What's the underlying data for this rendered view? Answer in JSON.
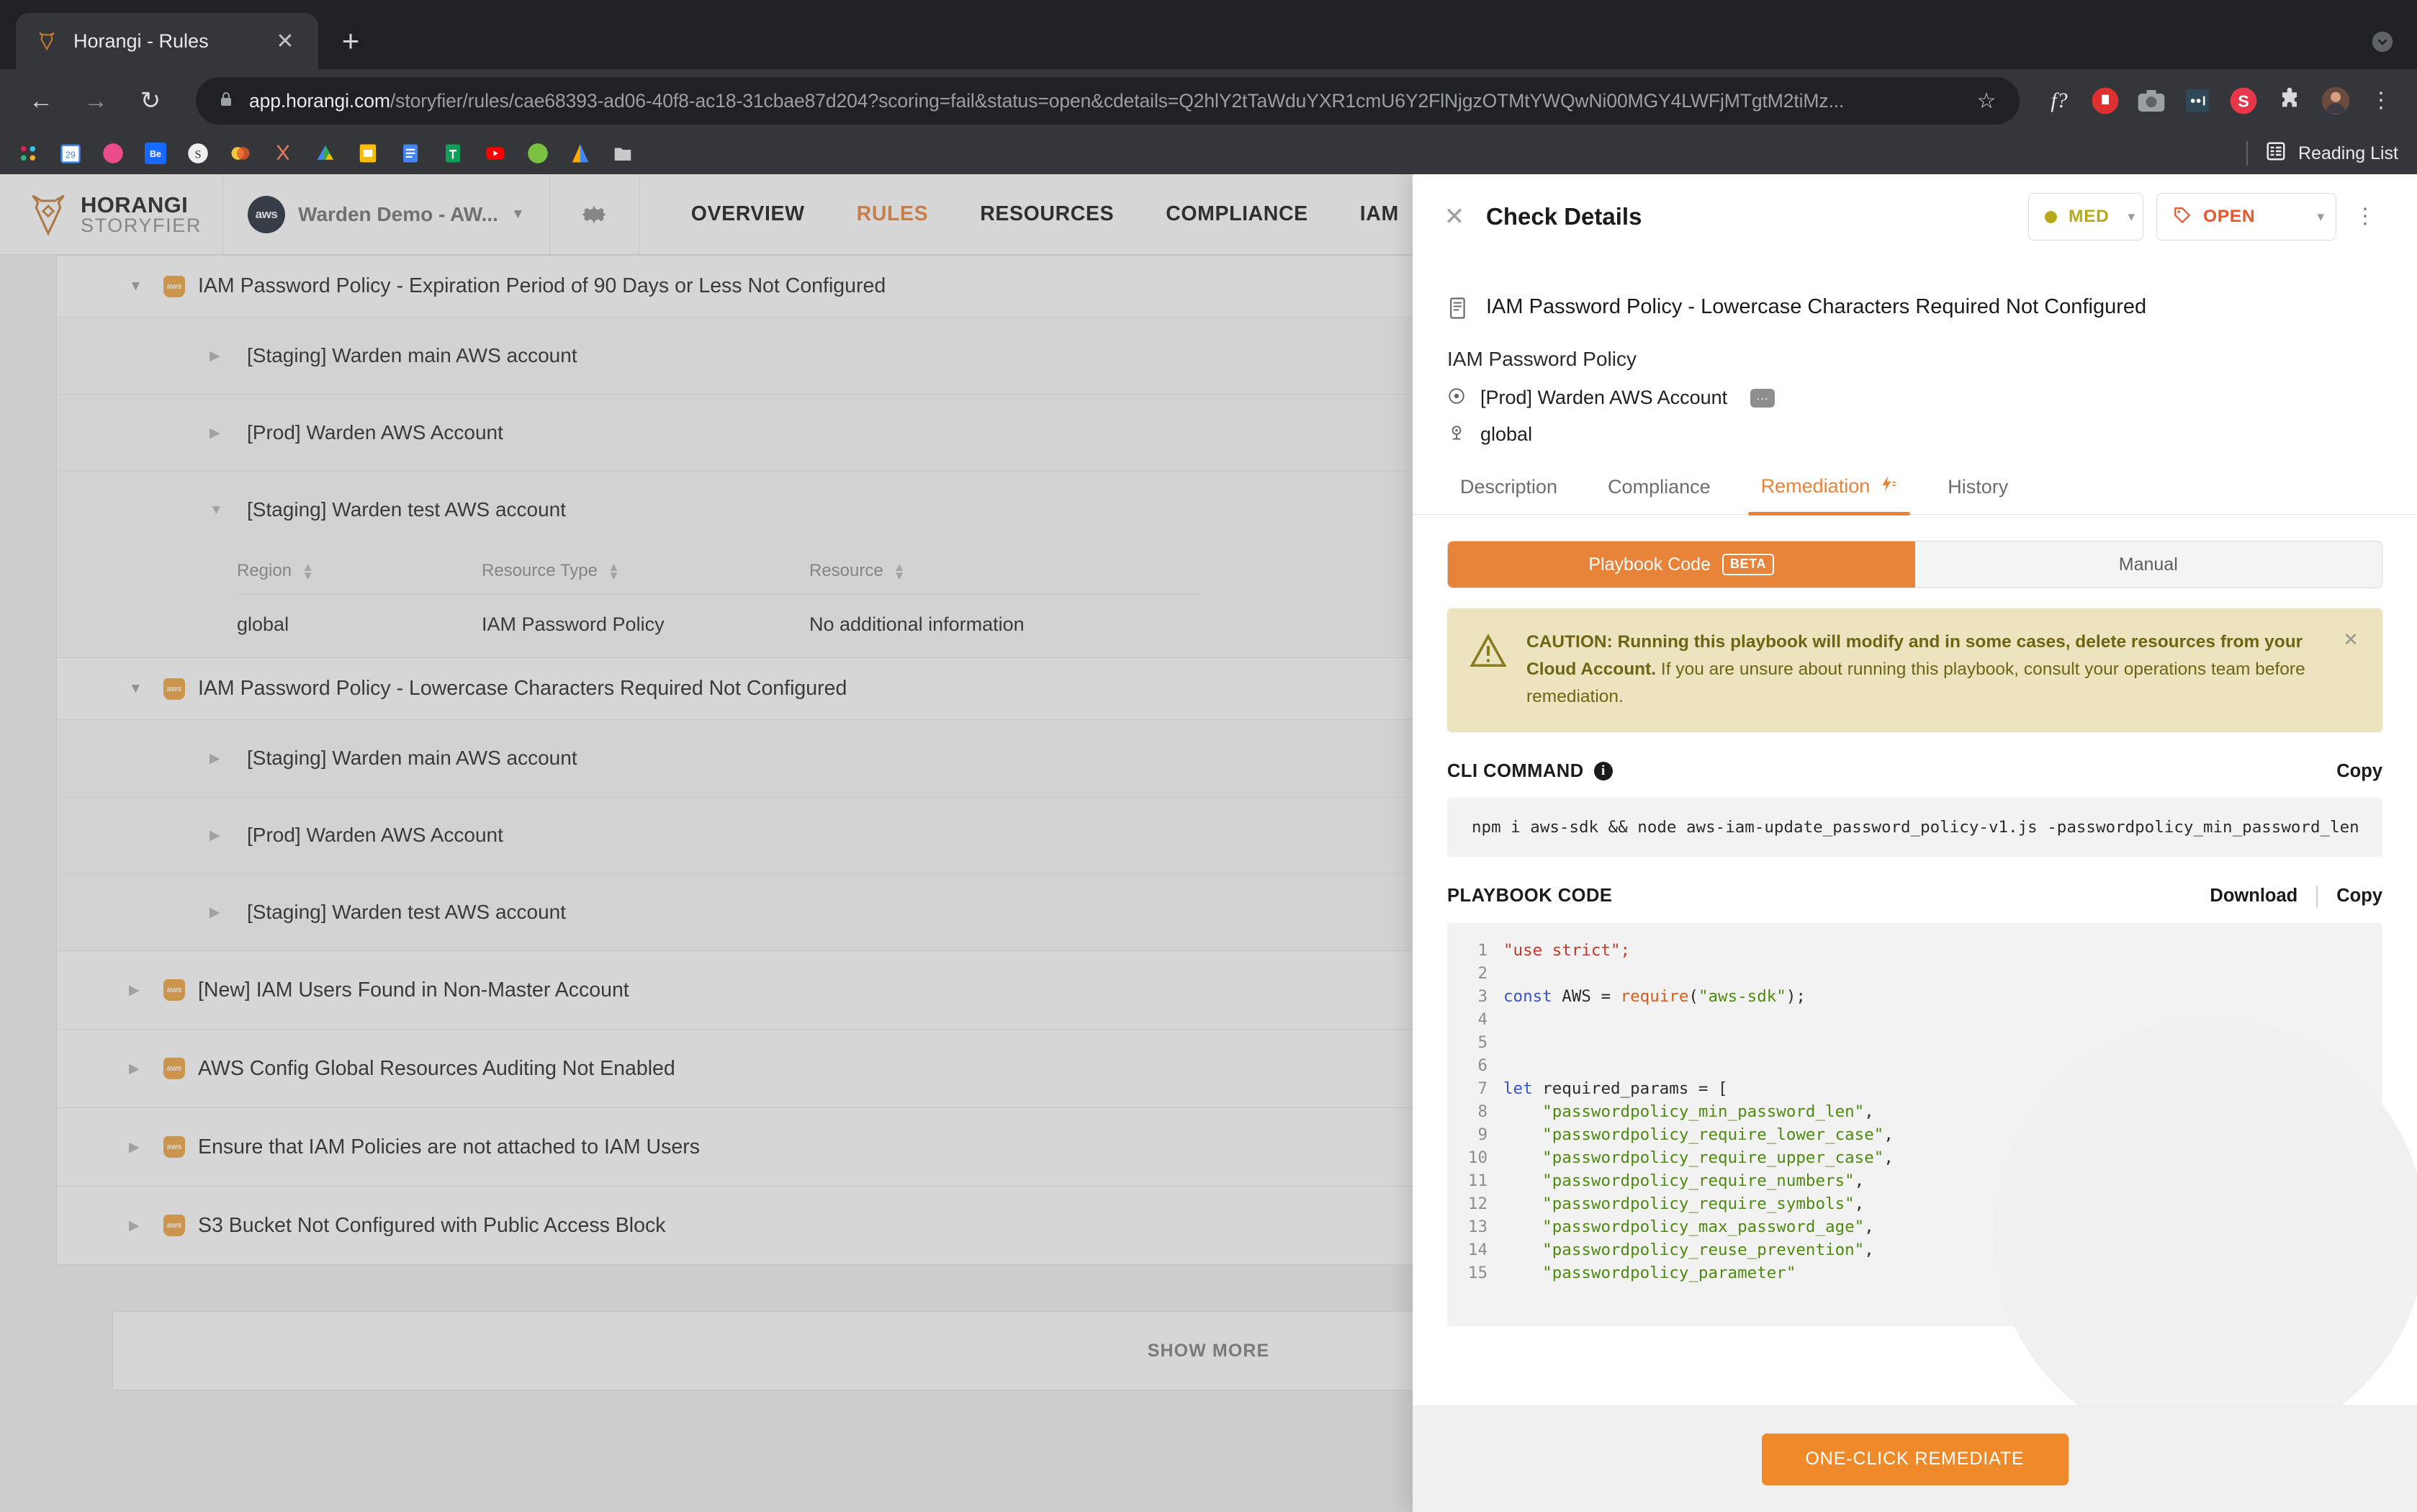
{
  "browser": {
    "tab": {
      "title": "Horangi - Rules",
      "favicon_icon": "horangi-favicon",
      "close_icon": "close-icon"
    },
    "new_tab_icon": "plus-icon",
    "window_collapse_icon": "chevron-down-circle-icon",
    "back_icon": "arrow-left-icon",
    "forward_icon": "arrow-right-icon",
    "reload_icon": "reload-icon",
    "lock_icon": "lock-icon",
    "url_host": "app.horangi.com",
    "url_path": "/storyfier/rules/cae68393-ad06-40f8-ac18-31cbae87d204?scoring=fail&status=open&cdetails=Q2hlY2tTaWduYXR1cmU6Y2FlNjgzOTMtYWQwNi00MGY4LWFjMTgtM2tiMz...",
    "star_icon": "bookmark-star-icon",
    "extensions": [
      "fx-icon",
      "adblock-icon",
      "screenshot-icon",
      "dots-extension-icon",
      "s-extension-icon",
      "puzzle-icon",
      "profile-avatar"
    ],
    "menu_icon": "kebab-menu-icon",
    "bookmarks": [
      "slack-icon",
      "calendar-icon",
      "dribbble-icon",
      "behance-icon",
      "invision-icon",
      "colors-icon",
      "scissors-icon",
      "drive-icon",
      "keep-icon",
      "docs-icon",
      "sheets-icon",
      "youtube-icon",
      "evernote-icon",
      "analytics-icon",
      "folder-icon"
    ],
    "reading_list": {
      "label": "Reading List",
      "icon": "reading-list-icon"
    }
  },
  "app": {
    "logo": {
      "line1": "HORANGI",
      "line2": "STORYFIER",
      "icon": "horangi-tiger-logo"
    },
    "account": {
      "name": "Warden Demo - AW...",
      "badge": "aws",
      "caret_icon": "chevron-down-icon"
    },
    "settings_icon": "gear-icon",
    "nav": [
      {
        "label": "OVERVIEW",
        "active": false
      },
      {
        "label": "RULES",
        "active": true
      },
      {
        "label": "RESOURCES",
        "active": false
      },
      {
        "label": "COMPLIANCE",
        "active": false
      },
      {
        "label": "IAM",
        "active": false
      }
    ]
  },
  "rules": {
    "rule1": {
      "title": "IAM Password Policy - Expiration Period of 90 Days or Less Not Configured",
      "cloud_icon": "aws-icon",
      "accounts": [
        {
          "label": "[Staging] Warden main AWS account",
          "expanded": false
        },
        {
          "label": "[Prod] Warden AWS Account",
          "expanded": false
        },
        {
          "label": "[Staging] Warden test AWS account",
          "expanded": true
        }
      ],
      "table": {
        "columns": [
          "Region",
          "Resource Type",
          "Resource"
        ],
        "rows": [
          [
            "global",
            "IAM Password Policy",
            "No additional information"
          ]
        ]
      }
    },
    "rule2": {
      "title": "IAM Password Policy - Lowercase Characters Required Not Configured",
      "cloud_icon": "aws-icon",
      "accounts": [
        {
          "label": "[Staging] Warden main AWS account"
        },
        {
          "label": "[Prod] Warden AWS Account"
        },
        {
          "label": "[Staging] Warden test AWS account"
        }
      ]
    },
    "collapsed": [
      {
        "label": "[New] IAM Users Found in Non-Master Account"
      },
      {
        "label": "AWS Config Global Resources Auditing Not Enabled"
      },
      {
        "label": "Ensure that IAM Policies are not attached to IAM Users"
      },
      {
        "label": "S3 Bucket Not Configured with Public Access Block"
      }
    ],
    "show_more": "SHOW MORE"
  },
  "drawer": {
    "close_icon": "close-icon",
    "title": "Check Details",
    "severity": {
      "label": "MED",
      "color": "#b8a91c",
      "chevron_icon": "chevron-down-icon"
    },
    "status": {
      "label": "OPEN",
      "color": "#e8562a",
      "tag_icon": "tag-icon",
      "chevron_icon": "chevron-down-icon"
    },
    "menu_icon": "kebab-menu-icon",
    "check_title": "IAM Password Policy - Lowercase Characters Required Not Configured",
    "check_title_icon": "document-icon",
    "meta": {
      "resource_type": "IAM Password Policy",
      "account": "[Prod] Warden AWS Account",
      "account_icon": "target-icon",
      "account_badge": "...",
      "region": "global",
      "region_icon": "location-pin-icon"
    },
    "tabs": [
      {
        "label": "Description",
        "active": false
      },
      {
        "label": "Compliance",
        "active": false
      },
      {
        "label": "Remediation",
        "active": true,
        "icon": "lightning-icon"
      },
      {
        "label": "History",
        "active": false
      }
    ],
    "segments": [
      {
        "label": "Playbook Code",
        "badge": "BETA",
        "active": true
      },
      {
        "label": "Manual",
        "active": false
      }
    ],
    "caution": {
      "icon": "warning-triangle-icon",
      "bold": "CAUTION: Running this playbook will modify and in some cases, delete resources from your Cloud Account.",
      "rest": " If you are unsure about running this playbook, consult your operations team before remediation.",
      "close_icon": "close-icon"
    },
    "cli": {
      "label": "CLI COMMAND",
      "info_icon": "info-icon",
      "copy": "Copy",
      "command": "npm i aws-sdk && node aws-iam-update_password_policy-v1.js -passwordpolicy_min_password_len"
    },
    "playbook": {
      "label": "PLAYBOOK CODE",
      "download": "Download",
      "copy": "Copy",
      "lines": [
        {
          "n": 1,
          "tokens": [
            {
              "t": "\"use strict\";",
              "c": "sr"
            }
          ]
        },
        {
          "n": 2,
          "tokens": []
        },
        {
          "n": 3,
          "tokens": [
            {
              "t": "const",
              "c": "k"
            },
            {
              "t": " AWS = ",
              "c": "code"
            },
            {
              "t": "require",
              "c": "f"
            },
            {
              "t": "(",
              "c": "code"
            },
            {
              "t": "\"aws-sdk\"",
              "c": "s"
            },
            {
              "t": ");",
              "c": "code"
            }
          ]
        },
        {
          "n": 4,
          "tokens": []
        },
        {
          "n": 5,
          "tokens": []
        },
        {
          "n": 6,
          "tokens": []
        },
        {
          "n": 7,
          "tokens": [
            {
              "t": "let",
              "c": "k"
            },
            {
              "t": " required_params = [",
              "c": "code"
            }
          ]
        },
        {
          "n": 8,
          "tokens": [
            {
              "t": "    \"passwordpolicy_min_password_len\"",
              "c": "s"
            },
            {
              "t": ",",
              "c": "code"
            }
          ]
        },
        {
          "n": 9,
          "tokens": [
            {
              "t": "    \"passwordpolicy_require_lower_case\"",
              "c": "s"
            },
            {
              "t": ",",
              "c": "code"
            }
          ]
        },
        {
          "n": 10,
          "tokens": [
            {
              "t": "    \"passwordpolicy_require_upper_case\"",
              "c": "s"
            },
            {
              "t": ",",
              "c": "code"
            }
          ]
        },
        {
          "n": 11,
          "tokens": [
            {
              "t": "    \"passwordpolicy_require_numbers\"",
              "c": "s"
            },
            {
              "t": ",",
              "c": "code"
            }
          ]
        },
        {
          "n": 12,
          "tokens": [
            {
              "t": "    \"passwordpolicy_require_symbols\"",
              "c": "s"
            },
            {
              "t": ",",
              "c": "code"
            }
          ]
        },
        {
          "n": 13,
          "tokens": [
            {
              "t": "    \"passwordpolicy_max_password_age\"",
              "c": "s"
            },
            {
              "t": ",",
              "c": "code"
            }
          ]
        },
        {
          "n": 14,
          "tokens": [
            {
              "t": "    \"passwordpolicy_reuse_prevention\"",
              "c": "s"
            },
            {
              "t": ",",
              "c": "code"
            }
          ]
        },
        {
          "n": 15,
          "tokens": [
            {
              "t": "    \"passwordpolicy_parameter\"",
              "c": "s"
            }
          ]
        }
      ]
    },
    "remediate_button": "ONE-CLICK REMEDIATE"
  }
}
